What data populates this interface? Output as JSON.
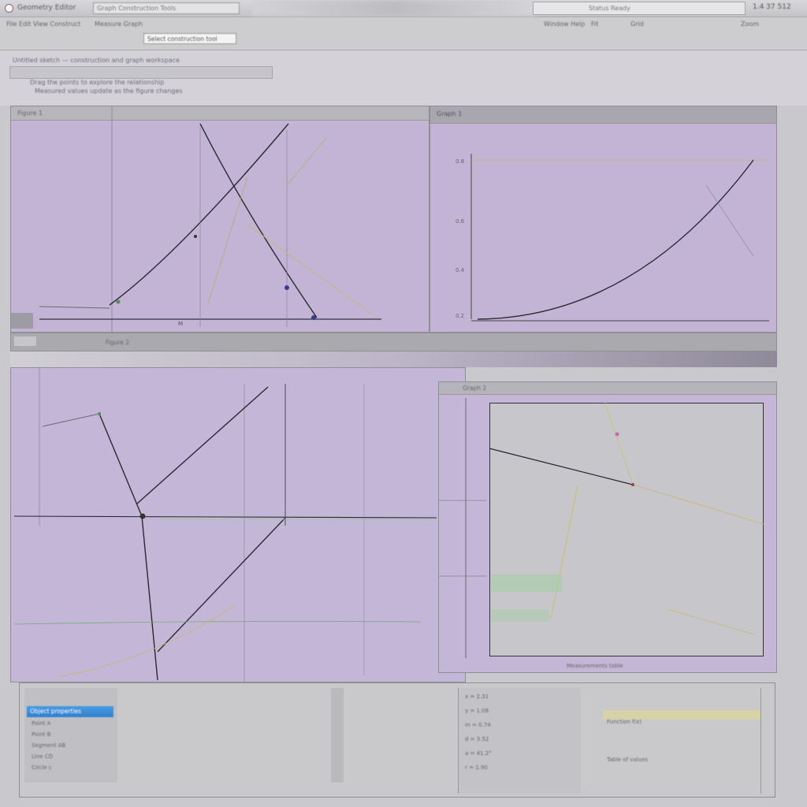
{
  "window": {
    "title": "Geometry Editor",
    "title_field": "Graph Construction Tools",
    "right_field": "Status Ready",
    "stats": "1.4 37 512"
  },
  "toolbar": {
    "row1": [
      "File Edit View Construct",
      "Measure Graph",
      "Window Help"
    ],
    "mode_field": "Select construction tool",
    "right_labels": [
      "Zoom",
      "Grid",
      "Fit"
    ]
  },
  "header": {
    "line1": "Untitled sketch — construction and graph workspace",
    "line2": "Drag the points to explore the relationship",
    "line3": "Measured values update as the figure changes"
  },
  "panels": {
    "top_left": {
      "head": "Figure 1"
    },
    "top_right": {
      "head": "Graph 1"
    },
    "mid_band": {
      "label": "Figure 2"
    },
    "bottom_left": {
      "head": ""
    },
    "bottom_right": {
      "head": "Graph 2"
    }
  },
  "graph_right_labels": {
    "bottom_caption": "Measurements table",
    "y_ticks": [
      "0.8",
      "0.6",
      "0.4",
      "0.2"
    ]
  },
  "bottom_panel": {
    "selected": "Object properties",
    "left_rows": [
      "Point A",
      "Point B",
      "Segment AB",
      "Line CD",
      "Circle c"
    ],
    "mid_rows": [
      "x = 2.31",
      "y = 1.08",
      "m = 0.74",
      "d = 3.52",
      "a = 41.2°",
      "r = 1.90"
    ],
    "right_rows": [
      "Function f(x)",
      "Table of values"
    ]
  },
  "colors": {
    "panel_bg": "#c3b3d4",
    "graph_bg": "#c7c6cb",
    "accent": "#2f7fd0",
    "line": "#2a2a35"
  },
  "icons": [
    "app-icon"
  ]
}
